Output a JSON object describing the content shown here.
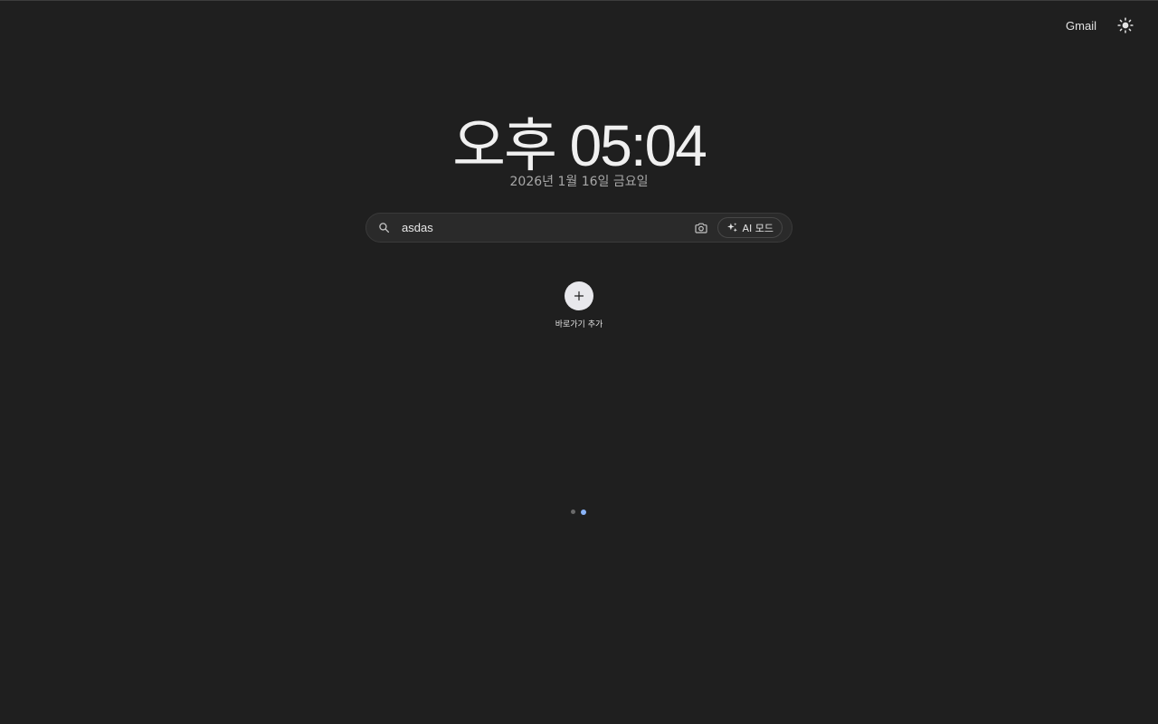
{
  "top_bar": {
    "gmail_label": "Gmail",
    "theme_icon": "sun-icon"
  },
  "clock": {
    "time": "오후 05:04",
    "date": "2026년 1월 16일 금요일"
  },
  "search": {
    "value": "asdas",
    "icons": [
      "search-icon",
      "camera-icon",
      "sparkle-icon"
    ],
    "ai_mode_label": "AI 모드"
  },
  "shortcut": {
    "label": "바로가기 추가",
    "icon": "plus-icon"
  },
  "pager": {
    "pages": 2,
    "active_index": 1
  },
  "colors": {
    "background": "#1f1f1f",
    "search_bg": "#2a2a2a",
    "active_dot": "#8ab4f8"
  }
}
